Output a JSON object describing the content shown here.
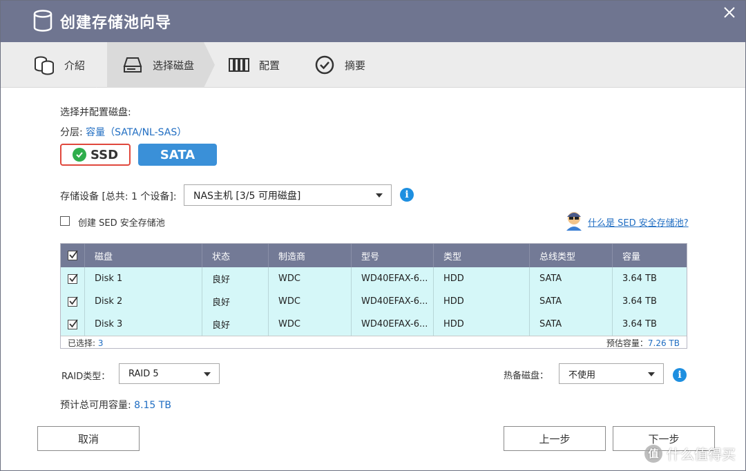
{
  "window": {
    "title": "创建存储池向导",
    "icons": [
      "database-icon",
      "close-icon"
    ]
  },
  "steps": [
    {
      "label": "介紹",
      "icon": "disks-icon",
      "active": false
    },
    {
      "label": "选择磁盘",
      "icon": "hard-drive-icon",
      "active": true
    },
    {
      "label": "配置",
      "icon": "raid-config-icon",
      "active": false
    },
    {
      "label": "摘要",
      "icon": "check-circle-icon",
      "active": false
    }
  ],
  "main": {
    "heading": "选择并配置磁盘:",
    "tier_prefix": "分层: ",
    "tier_value": "容量（SATA/NL-SAS）",
    "tier_buttons": {
      "ssd": "SSD",
      "sata": "SATA"
    },
    "device_label": "存储设备 [总共: 1 个设备]:",
    "device_select": "NAS主机 [3/5 可用磁盘]",
    "sed_checkbox_label": "创建 SED 安全存储池",
    "sed_link": "什么是 SED 安全存储池?",
    "colors": {
      "accent": "#3a90d8",
      "header": "#737a96",
      "row_bg": "#d5f7f8",
      "link": "#1f6dc2"
    }
  },
  "table": {
    "headers": [
      "磁盘",
      "状态",
      "制造商",
      "型号",
      "类型",
      "总线类型",
      "容量"
    ],
    "rows": [
      {
        "disk": "Disk 1",
        "status": "良好",
        "vendor": "WDC",
        "model": "WD40EFAX-6...",
        "type": "HDD",
        "bus": "SATA",
        "capacity": "3.64 TB"
      },
      {
        "disk": "Disk 2",
        "status": "良好",
        "vendor": "WDC",
        "model": "WD40EFAX-6...",
        "type": "HDD",
        "bus": "SATA",
        "capacity": "3.64 TB"
      },
      {
        "disk": "Disk 3",
        "status": "良好",
        "vendor": "WDC",
        "model": "WD40EFAX-6...",
        "type": "HDD",
        "bus": "SATA",
        "capacity": "3.64 TB"
      }
    ],
    "selected_label": "已选择: ",
    "selected_count": "3",
    "estimated_label": "预估容量：",
    "estimated_value": "7.26 TB"
  },
  "raid": {
    "label": "RAID类型：",
    "value": "RAID 5",
    "spare_label": "热备磁盘：",
    "spare_value": "不使用"
  },
  "capacity": {
    "label": "预计总可用容量: ",
    "value": "8.15 TB"
  },
  "buttons": {
    "cancel": "取消",
    "back": "上一步",
    "next": "下一步"
  },
  "watermark": {
    "symbol": "值",
    "text": "什么值得买"
  }
}
